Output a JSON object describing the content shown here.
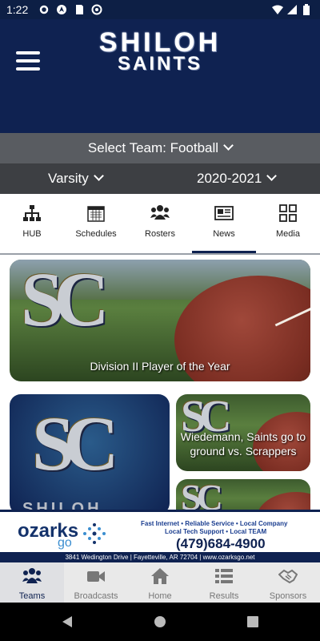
{
  "status_bar": {
    "time": "1:22"
  },
  "header": {
    "logo_line1": "SHILOH",
    "logo_line2": "SAINTS"
  },
  "team_selector": {
    "label": "Select Team: Football"
  },
  "level_selector": {
    "level": "Varsity",
    "season": "2020-2021"
  },
  "tabs": [
    {
      "label": "HUB",
      "icon": "hub-icon"
    },
    {
      "label": "Schedules",
      "icon": "calendar-icon"
    },
    {
      "label": "Rosters",
      "icon": "people-icon"
    },
    {
      "label": "News",
      "icon": "newspaper-icon",
      "active": true
    },
    {
      "label": "Media",
      "icon": "grid-icon"
    }
  ],
  "news": {
    "featured": {
      "title": "Division II Player of the Year"
    },
    "secondary": {
      "title": "Wiedemann, Saints go to ground vs. Scrappers"
    },
    "side_logo_text": "SHILOH"
  },
  "ad": {
    "brand": "ozarks",
    "brand_sub": "go",
    "line1": "Fast Internet • Reliable Service • Local Company",
    "line2": "Local Tech Support • Local TEAM",
    "phone": "(479)684-4900",
    "address": "3841 Wedington Drive | Fayetteville, AR 72704 | www.ozarksgo.net"
  },
  "bottom_nav": [
    {
      "label": "Teams",
      "icon": "teams-icon",
      "active": true
    },
    {
      "label": "Broadcasts",
      "icon": "video-camera-icon"
    },
    {
      "label": "Home",
      "icon": "home-icon"
    },
    {
      "label": "Results",
      "icon": "list-icon"
    },
    {
      "label": "Sponsors",
      "icon": "handshake-icon"
    }
  ],
  "colors": {
    "navy": "#0f2251",
    "teambar": "#595c61",
    "levelbar": "#3d3f43"
  }
}
